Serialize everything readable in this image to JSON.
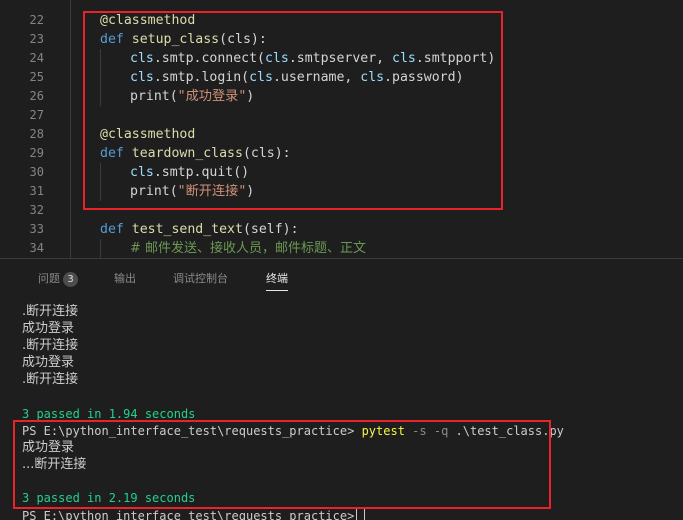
{
  "editor": {
    "line_numbers": [
      "22",
      "23",
      "24",
      "25",
      "26",
      "27",
      "28",
      "29",
      "30",
      "31",
      "32",
      "33",
      "34"
    ],
    "code": {
      "l22_decorator": "@classmethod",
      "l23_def": "def",
      "l23_fn": "setup_class",
      "l23_rest": "(cls):",
      "l24_cls1": "cls",
      "l24_a": ".smtp.connect(",
      "l24_cls2": "cls",
      "l24_b": ".smtpserver, ",
      "l24_cls3": "cls",
      "l24_c": ".smtpport)",
      "l25_cls1": "cls",
      "l25_a": ".smtp.login(",
      "l25_cls2": "cls",
      "l25_b": ".username, ",
      "l25_cls3": "cls",
      "l25_c": ".password)",
      "l26_print": "print(",
      "l26_str": "\"成功登录\"",
      "l26_close": ")",
      "l28_decorator": "@classmethod",
      "l29_def": "def",
      "l29_fn": "teardown_class",
      "l29_rest": "(cls):",
      "l30_cls": "cls",
      "l30_rest": ".smtp.quit()",
      "l31_print": "print(",
      "l31_str": "\"断开连接\"",
      "l31_close": ")",
      "l33_def": "def",
      "l33_fn": "test_send_text",
      "l33_rest": "(self):",
      "l34_comment": "# 邮件发送、接收人员，邮件标题、正文"
    }
  },
  "panel": {
    "tabs": [
      {
        "label": "问题",
        "badge": "3"
      },
      {
        "label": "输出"
      },
      {
        "label": "调试控制台"
      },
      {
        "label": "终端"
      }
    ],
    "active_tab": "终端"
  },
  "terminal": {
    "lines": [
      ".断开连接",
      "成功登录",
      ".断开连接",
      "成功登录",
      ".断开连接",
      "",
      "3 passed in 1.94 seconds",
      "PS E:\\python_interface_test\\requests_practice>",
      "pytest",
      "-s -q",
      ".\\test_class.py",
      "成功登录",
      "...断开连接",
      "",
      "3 passed in 2.19 seconds",
      "PS E:\\python_interface_test\\requests_practice>"
    ]
  },
  "colors": {
    "highlight_box": "#e8232a",
    "pass_green": "#23d18b",
    "command_yellow": "#f5f543"
  }
}
